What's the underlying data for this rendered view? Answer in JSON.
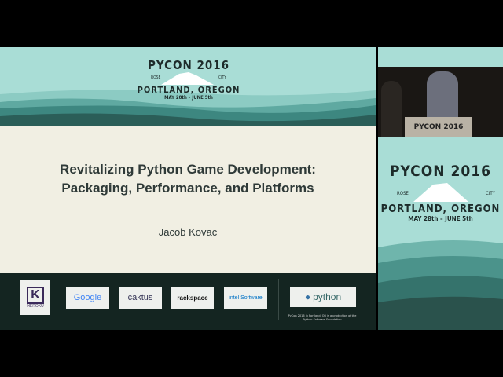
{
  "slide": {
    "logo": {
      "title": "PYCON 2016",
      "left": "ROSE",
      "right": "CITY",
      "city": "PORTLAND, OREGON",
      "dates": "MAY 28th – JUNE 5th"
    },
    "title_line1": "Revitalizing Python Game Development:",
    "title_line2": "Packaging, Performance, and Platforms",
    "author": "Jacob Kovac",
    "sponsors": [
      "HEROKU",
      "Google",
      "caktus",
      "rackspace",
      "intel Software",
      "python"
    ],
    "footnote": "PyCon 2016 in Portland, OR is a production of the Python Software Foundation"
  },
  "podium": {
    "label": "PYCON 2016"
  },
  "side_logo": {
    "title": "PYCON 2016",
    "left": "ROSE",
    "right": "CITY",
    "city": "PORTLAND, OREGON",
    "dates": "MAY 28th – JUNE 5th"
  }
}
